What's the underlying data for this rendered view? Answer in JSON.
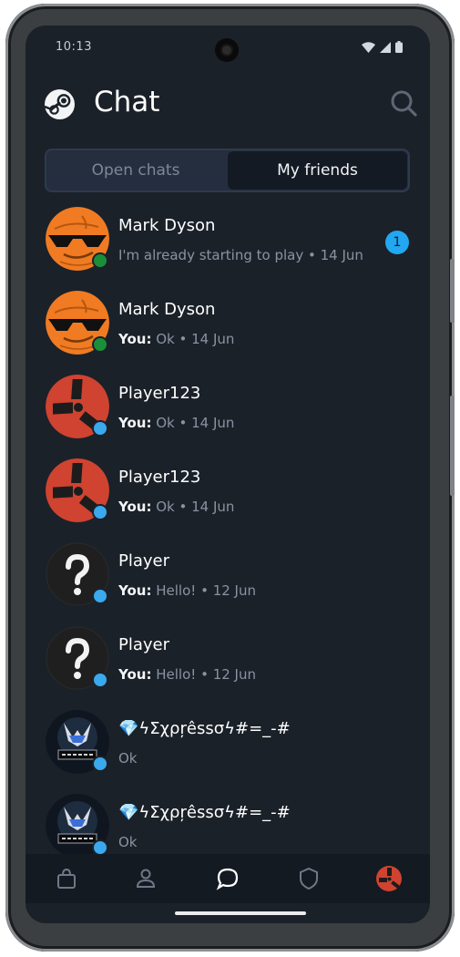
{
  "status_bar": {
    "time": "10:13",
    "icons": [
      "wifi-icon",
      "signal-icon",
      "battery-icon"
    ]
  },
  "header": {
    "title": "Chat",
    "logo": "steam-logo-icon",
    "search_icon": "search-icon"
  },
  "tabs": [
    {
      "label": "Open chats",
      "active": false
    },
    {
      "label": "My friends",
      "active": true
    }
  ],
  "you_label": "You:",
  "chats": [
    {
      "name": "Mark Dyson",
      "from_you": false,
      "message": "I'm already starting to play",
      "date": "14 Jun",
      "unread": "1",
      "status_color": "#1db954",
      "avatar": "sunglasses-face-avatar"
    },
    {
      "name": "Mark Dyson",
      "from_you": true,
      "message": "Ok",
      "date": "14 Jun",
      "unread": "",
      "status_color": "#1db954",
      "avatar": "sunglasses-face-avatar"
    },
    {
      "name": "Player123",
      "from_you": true,
      "message": "Ok",
      "date": "14 Jun",
      "unread": "",
      "status_color": "#3aa9ee",
      "avatar": "rust-logo-avatar"
    },
    {
      "name": "Player123",
      "from_you": true,
      "message": "Ok",
      "date": "14 Jun",
      "unread": "",
      "status_color": "#3aa9ee",
      "avatar": "rust-logo-avatar"
    },
    {
      "name": "Player",
      "from_you": true,
      "message": "Hello!",
      "date": "12 Jun",
      "unread": "",
      "status_color": "#3aa9ee",
      "avatar": "question-mark-avatar"
    },
    {
      "name": "Player",
      "from_you": true,
      "message": "Hello!",
      "date": "12 Jun",
      "unread": "",
      "status_color": "#3aa9ee",
      "avatar": "question-mark-avatar"
    },
    {
      "name": "💎ϟΣχρŗêssσϟ#=_-#",
      "from_you": false,
      "message": "Ok",
      "date": "",
      "unread": "",
      "status_color": "#3aa9ee",
      "avatar": "dark-emblem-avatar"
    },
    {
      "name": "💎ϟΣχρŗêssσϟ#=_-#",
      "from_you": false,
      "message": "Ok",
      "date": "",
      "unread": "",
      "status_color": "#3aa9ee",
      "avatar": "dark-emblem-avatar"
    }
  ],
  "bottom_nav": [
    {
      "icon": "store-bag-icon"
    },
    {
      "icon": "profile-icon"
    },
    {
      "icon": "chat-bubble-icon",
      "active": true
    },
    {
      "icon": "shield-icon"
    },
    {
      "icon": "rust-avatar-icon"
    }
  ],
  "colors": {
    "background": "#1b2129",
    "accent": "#22a7f0",
    "online": "#1db954"
  }
}
